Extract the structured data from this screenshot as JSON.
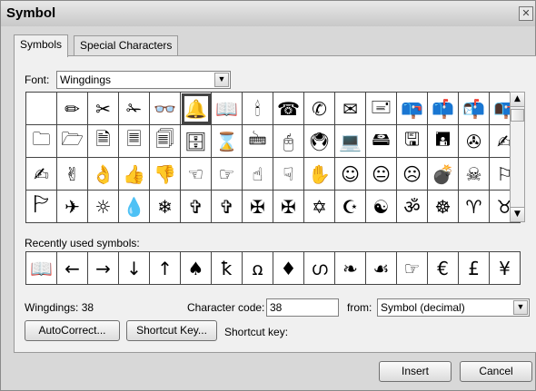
{
  "window": {
    "title": "Symbol",
    "close_glyph": "✕"
  },
  "tabs": [
    {
      "label": "Symbols",
      "active": true
    },
    {
      "label": "Special Characters",
      "active": false
    }
  ],
  "font": {
    "label": "Font:",
    "value": "Wingdings",
    "dropdown_glyph": "▼"
  },
  "symbol_grid": {
    "selected_index": 5,
    "cells": [
      "",
      "✏",
      "✂",
      "✁",
      "👓",
      "🔔",
      "📖",
      "🕯",
      "☎",
      "✆",
      "✉",
      "🖃",
      "📪",
      "📫",
      "📬",
      "📭",
      "🗀",
      "🗁",
      "🗎",
      "🗏",
      "🗐",
      "🗄",
      "⌛",
      "🖮",
      "🖰",
      "🖲",
      "💻",
      "🖴",
      "🖫",
      "🖪",
      "✇",
      "✍",
      "✍",
      "✌",
      "👌",
      "👍",
      "👎",
      "☜",
      "☞",
      "☝",
      "☟",
      "✋",
      "☺",
      "😐",
      "☹",
      "💣",
      "☠",
      "⚐",
      "🏱",
      "✈",
      "☼",
      "💧",
      "❄",
      "✞",
      "✞",
      "✠",
      "✠",
      "✡",
      "☪",
      "☯",
      "ॐ",
      "☸",
      "♈",
      "♉"
    ]
  },
  "scrollbar": {
    "up_glyph": "▲",
    "down_glyph": "▼"
  },
  "recent": {
    "label": "Recently used symbols:",
    "symbols": [
      "📖",
      "←",
      "→",
      "↓",
      "↑",
      "♠",
      "ꝁ",
      "ꭥ",
      "♦",
      "ഗ",
      "❧",
      "☙",
      "☞",
      "€",
      "£",
      "¥"
    ]
  },
  "info": {
    "font_code": "Wingdings: 38",
    "char_code_label": "Character code:",
    "char_code_value": "38",
    "from_label": "from:",
    "from_value": "Symbol (decimal)",
    "shortcut_label": "Shortcut key:"
  },
  "buttons": {
    "autocorrect": "AutoCorrect...",
    "shortcut": "Shortcut Key...",
    "insert": "Insert",
    "cancel": "Cancel"
  }
}
